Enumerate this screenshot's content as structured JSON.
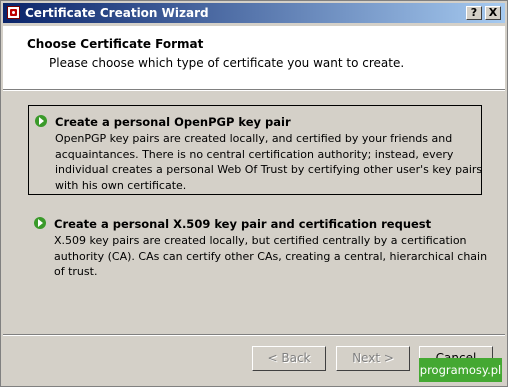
{
  "window": {
    "title": "Certificate Creation Wizard",
    "help_button": "?",
    "close_button": "X"
  },
  "header": {
    "title": "Choose Certificate Format",
    "subtitle": "Please choose which type of certificate you want to create."
  },
  "options": [
    {
      "title": "Create a personal OpenPGP key pair",
      "selected": true,
      "icon": "green-arrow-icon",
      "lines": [
        "OpenPGP key pairs are created locally, and certified by your friends and",
        "acquaintances. There is no central certification authority; instead, every",
        "individual creates a personal Web Of Trust by certifying other user's key pairs",
        "with his own certificate."
      ]
    },
    {
      "title": "Create a personal X.509 key pair and certification request",
      "selected": false,
      "icon": "green-arrow-icon",
      "lines": [
        "X.509 key pairs are created locally, but certified centrally by a certification",
        "authority (CA). CAs can certify other CAs, creating a central, hierarchical chain",
        "of trust."
      ]
    }
  ],
  "buttons": {
    "back": "< Back",
    "next": "Next >",
    "cancel": "Cancel"
  },
  "watermark": "programosy.pl",
  "colors": {
    "titlebar_start": "#0a246a",
    "titlebar_end": "#a6caf0",
    "dialog_bg": "#d4d0c8",
    "arrow_icon": "#3a9a2a",
    "watermark_bg": "#44a832"
  }
}
